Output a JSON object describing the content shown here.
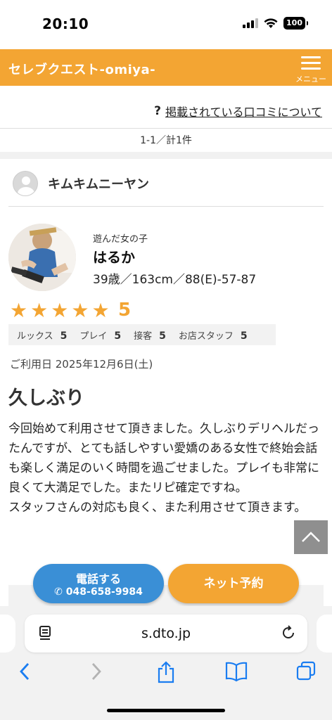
{
  "status": {
    "time": "20:10",
    "battery": "100"
  },
  "header": {
    "title": "セレブクエスト-omiya-",
    "menu_label": "メニュー"
  },
  "review_link": {
    "icon": "?",
    "text": "掲載されている口コミについて"
  },
  "pager": {
    "count": "1-1／計1件"
  },
  "reviewer": {
    "name": "キムキムニーヤン"
  },
  "girl": {
    "label": "遊んだ女の子",
    "name": "はるか",
    "profile": "39歳／163cm／88(E)-57-87"
  },
  "rating": {
    "stars": 5,
    "value": "5",
    "sub": [
      {
        "label": "ルックス",
        "value": "5"
      },
      {
        "label": "プレイ",
        "value": "5"
      },
      {
        "label": "接客",
        "value": "5"
      },
      {
        "label": "お店スタッフ",
        "value": "5"
      }
    ]
  },
  "review": {
    "date": "ご利用日 2025年12月6日(土)",
    "title": "久しぶり",
    "body": "今回始めて利用させて頂きました。久しぶりデリヘルだったんですが、とても話しやすい愛嬌のある女性で終始会話も楽しく満足のいく時間を過ごせました。プレイも非常に良くて大満足でした。またリピ確定ですね。\nスタッフさんの対応も良く、また利用させて頂きます。"
  },
  "actions": {
    "call_label": "電話する",
    "call_number": "048-658-9984",
    "net_label": "ネット予約"
  },
  "browser": {
    "url": "s.dto.jp"
  },
  "colors": {
    "accent": "#f3a533",
    "call": "#3a8fd6",
    "ios_blue": "#1a7df1"
  }
}
